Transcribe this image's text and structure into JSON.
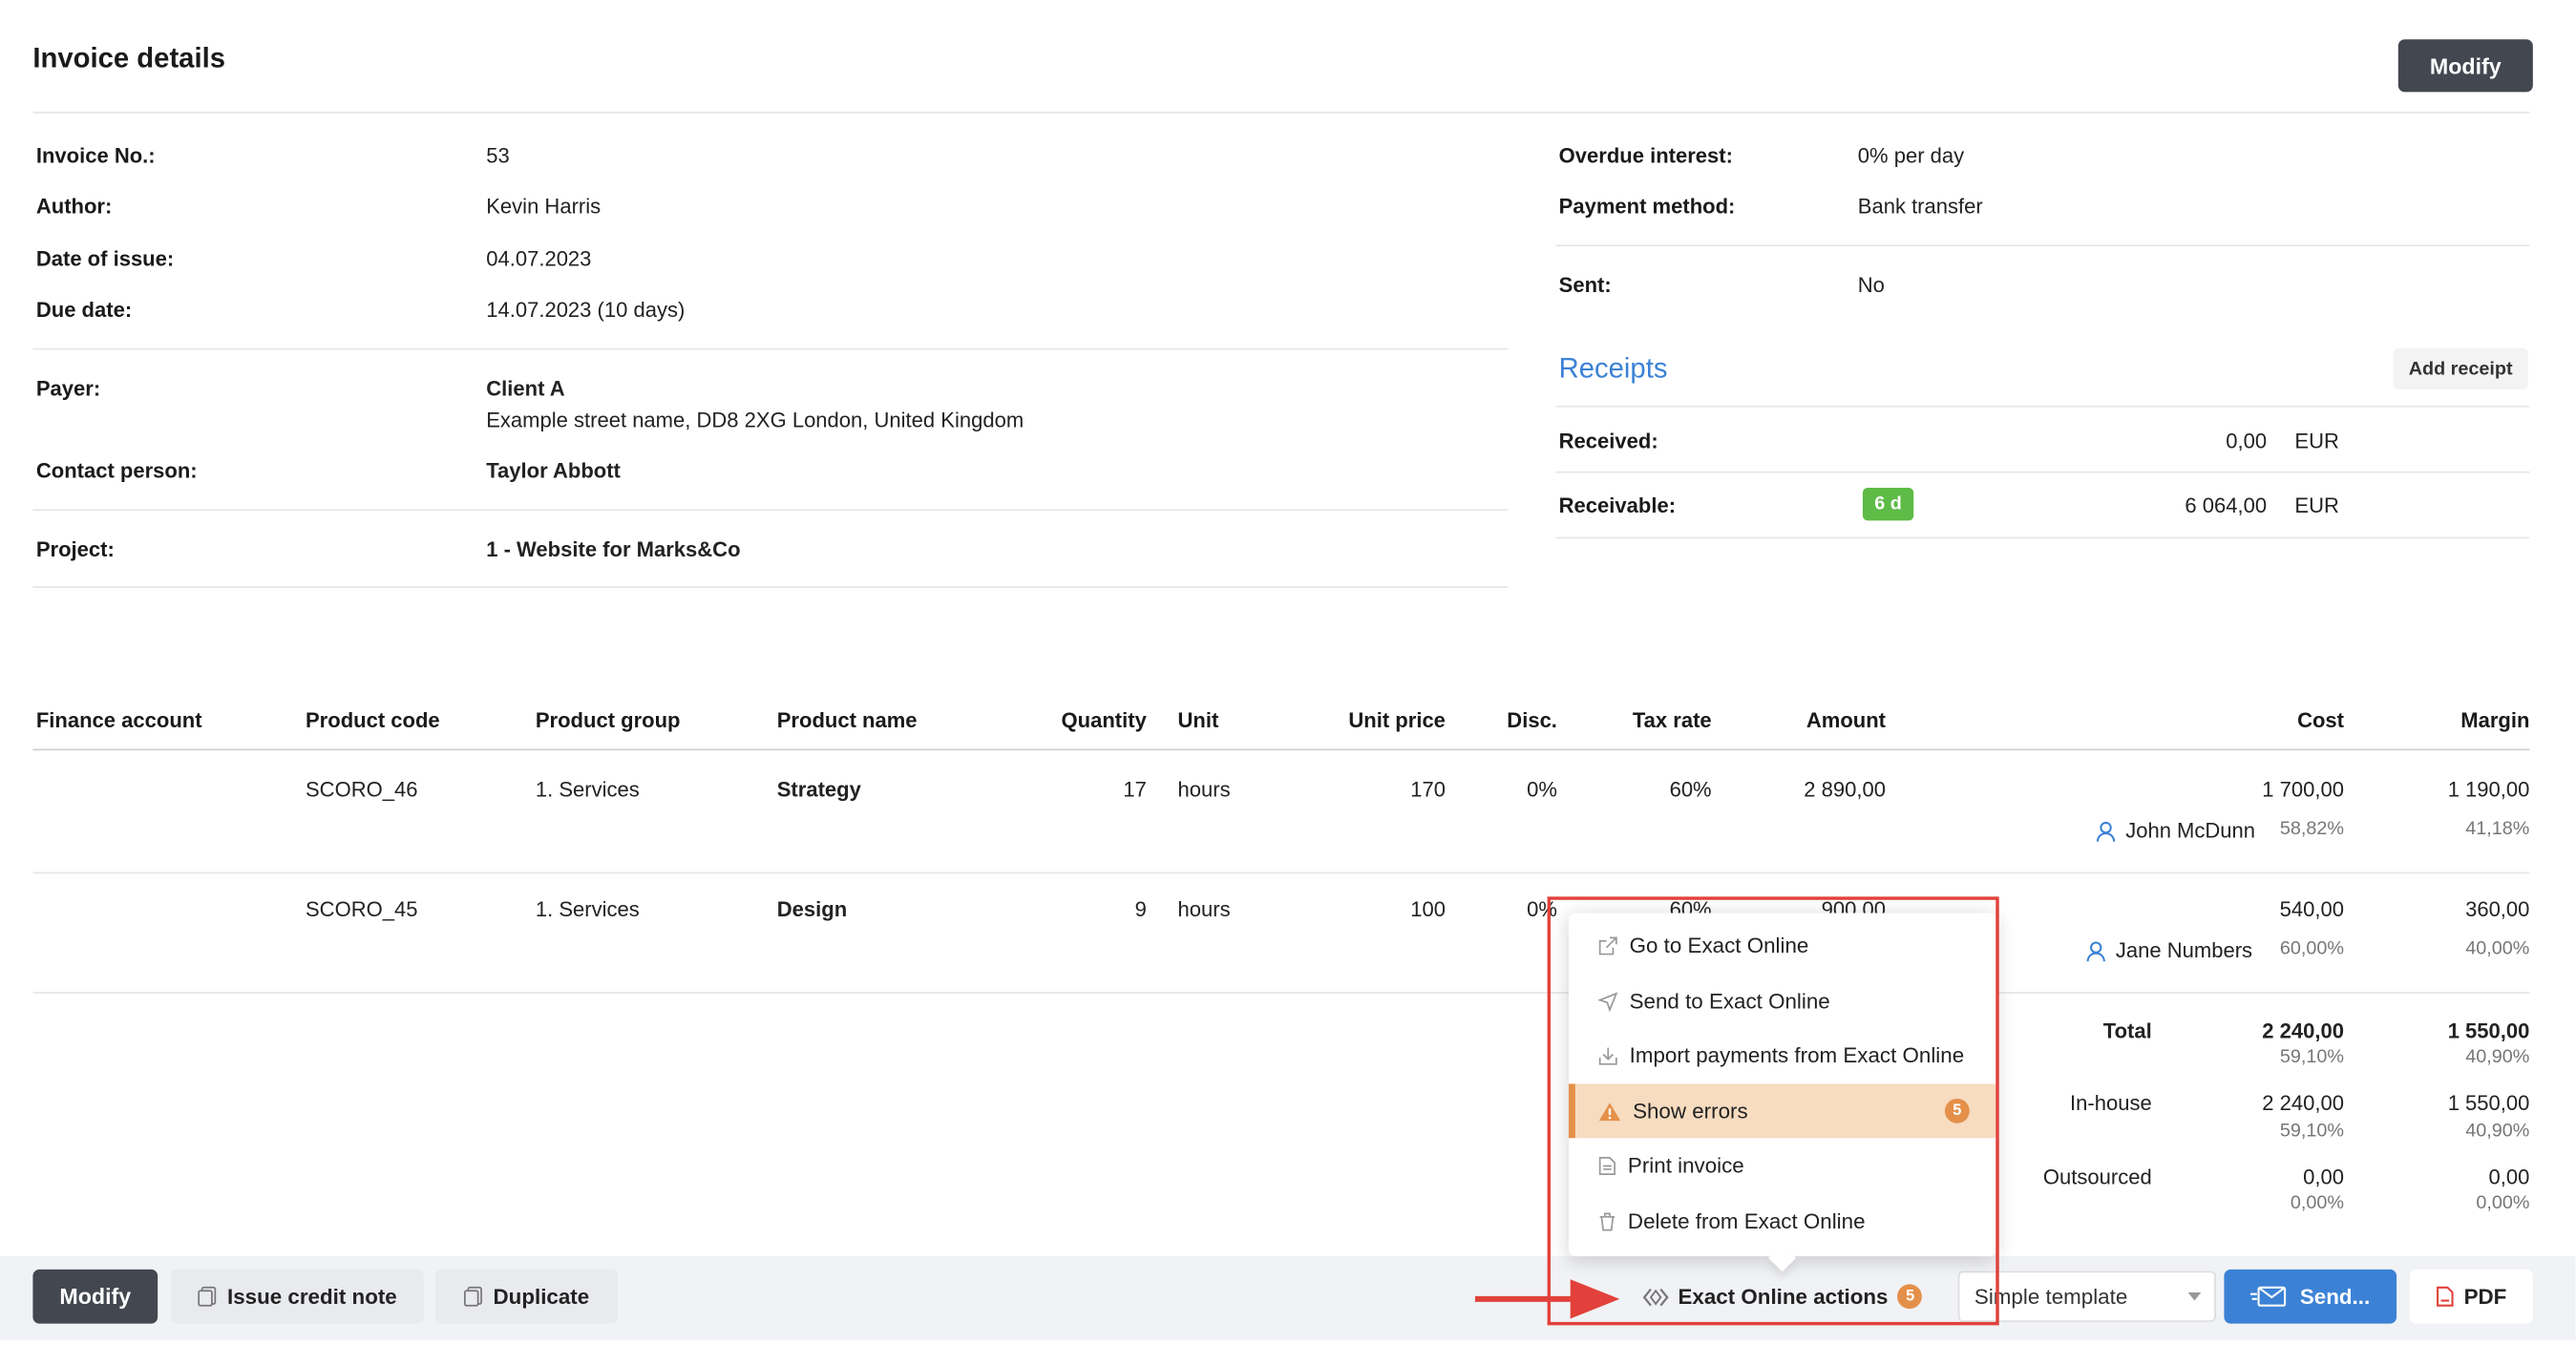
{
  "header": {
    "title": "Invoice details",
    "modify_label": "Modify"
  },
  "details_left": {
    "invoice_no_label": "Invoice No.:",
    "invoice_no": "53",
    "author_label": "Author:",
    "author": "Kevin Harris",
    "date_of_issue_label": "Date of issue:",
    "date_of_issue": "04.07.2023",
    "due_date_label": "Due date:",
    "due_date": "14.07.2023 (10 days)",
    "payer_label": "Payer:",
    "payer_name": "Client A",
    "payer_address": "Example street name, DD8 2XG London, United Kingdom",
    "contact_label": "Contact person:",
    "contact": "Taylor Abbott",
    "project_label": "Project:",
    "project": "1 - Website for Marks&Co"
  },
  "details_right": {
    "overdue_label": "Overdue interest:",
    "overdue": "0% per day",
    "payment_method_label": "Payment method:",
    "payment_method": "Bank transfer",
    "sent_label": "Sent:",
    "sent": "No"
  },
  "receipts": {
    "title": "Receipts",
    "add_label": "Add receipt",
    "received_label": "Received:",
    "received_value": "0,00",
    "received_currency": "EUR",
    "receivable_label": "Receivable:",
    "receivable_badge": "6 d",
    "receivable_value": "6 064,00",
    "receivable_currency": "EUR"
  },
  "table": {
    "headers": [
      "Finance account",
      "Product code",
      "Product group",
      "Product name",
      "Quantity",
      "Unit",
      "Unit price",
      "Disc.",
      "Tax rate",
      "Amount",
      "Cost",
      "Margin"
    ],
    "rows": [
      {
        "code": "SCORO_46",
        "group": "1. Services",
        "name": "Strategy",
        "qty": "17",
        "unit": "hours",
        "price": "170",
        "disc": "0%",
        "tax": "60%",
        "amount": "2 890,00",
        "cost": "1 700,00",
        "margin": "1 190,00",
        "person": "John McDunn",
        "cost_pct": "58,82%",
        "margin_pct": "41,18%"
      },
      {
        "code": "SCORO_45",
        "group": "1. Services",
        "name": "Design",
        "qty": "9",
        "unit": "hours",
        "price": "100",
        "disc": "0%",
        "tax": "60%",
        "amount": "900,00",
        "cost": "540,00",
        "margin": "360,00",
        "person": "Jane Numbers",
        "cost_pct": "60,00%",
        "margin_pct": "40,00%"
      }
    ]
  },
  "totals": {
    "total_label": "Total",
    "total_cost": "2 240,00",
    "total_cost_pct": "59,10%",
    "total_margin": "1 550,00",
    "total_margin_pct": "40,90%",
    "inhouse_label": "In-house",
    "inhouse_cost": "2 240,00",
    "inhouse_cost_pct": "59,10%",
    "inhouse_margin": "1 550,00",
    "inhouse_margin_pct": "40,90%",
    "outsourced_label": "Outsourced",
    "outsourced_cost": "0,00",
    "outsourced_cost_pct": "0,00%",
    "outsourced_margin": "0,00",
    "outsourced_margin_pct": "0,00%"
  },
  "menu": {
    "items": [
      {
        "label": "Go to Exact Online",
        "icon": "external-link-icon"
      },
      {
        "label": "Send to Exact Online",
        "icon": "send-icon"
      },
      {
        "label": "Import payments from Exact Online",
        "icon": "import-icon"
      },
      {
        "label": "Show errors",
        "icon": "warning-icon",
        "badge": "5"
      },
      {
        "label": "Print invoice",
        "icon": "document-icon"
      },
      {
        "label": "Delete from Exact Online",
        "icon": "trash-icon"
      }
    ]
  },
  "bottom": {
    "modify_label": "Modify",
    "credit_note_label": "Issue credit note",
    "duplicate_label": "Duplicate",
    "exact_actions_label": "Exact Online actions",
    "exact_actions_badge": "5",
    "template_value": "Simple template",
    "send_label": "Send...",
    "pdf_label": "PDF"
  },
  "colors": {
    "accent_blue": "#3b82d6",
    "dark_button": "#43474f",
    "warning_orange": "#e4904a",
    "highlight_red": "#e2413b",
    "badge_green": "#5dbb46"
  }
}
